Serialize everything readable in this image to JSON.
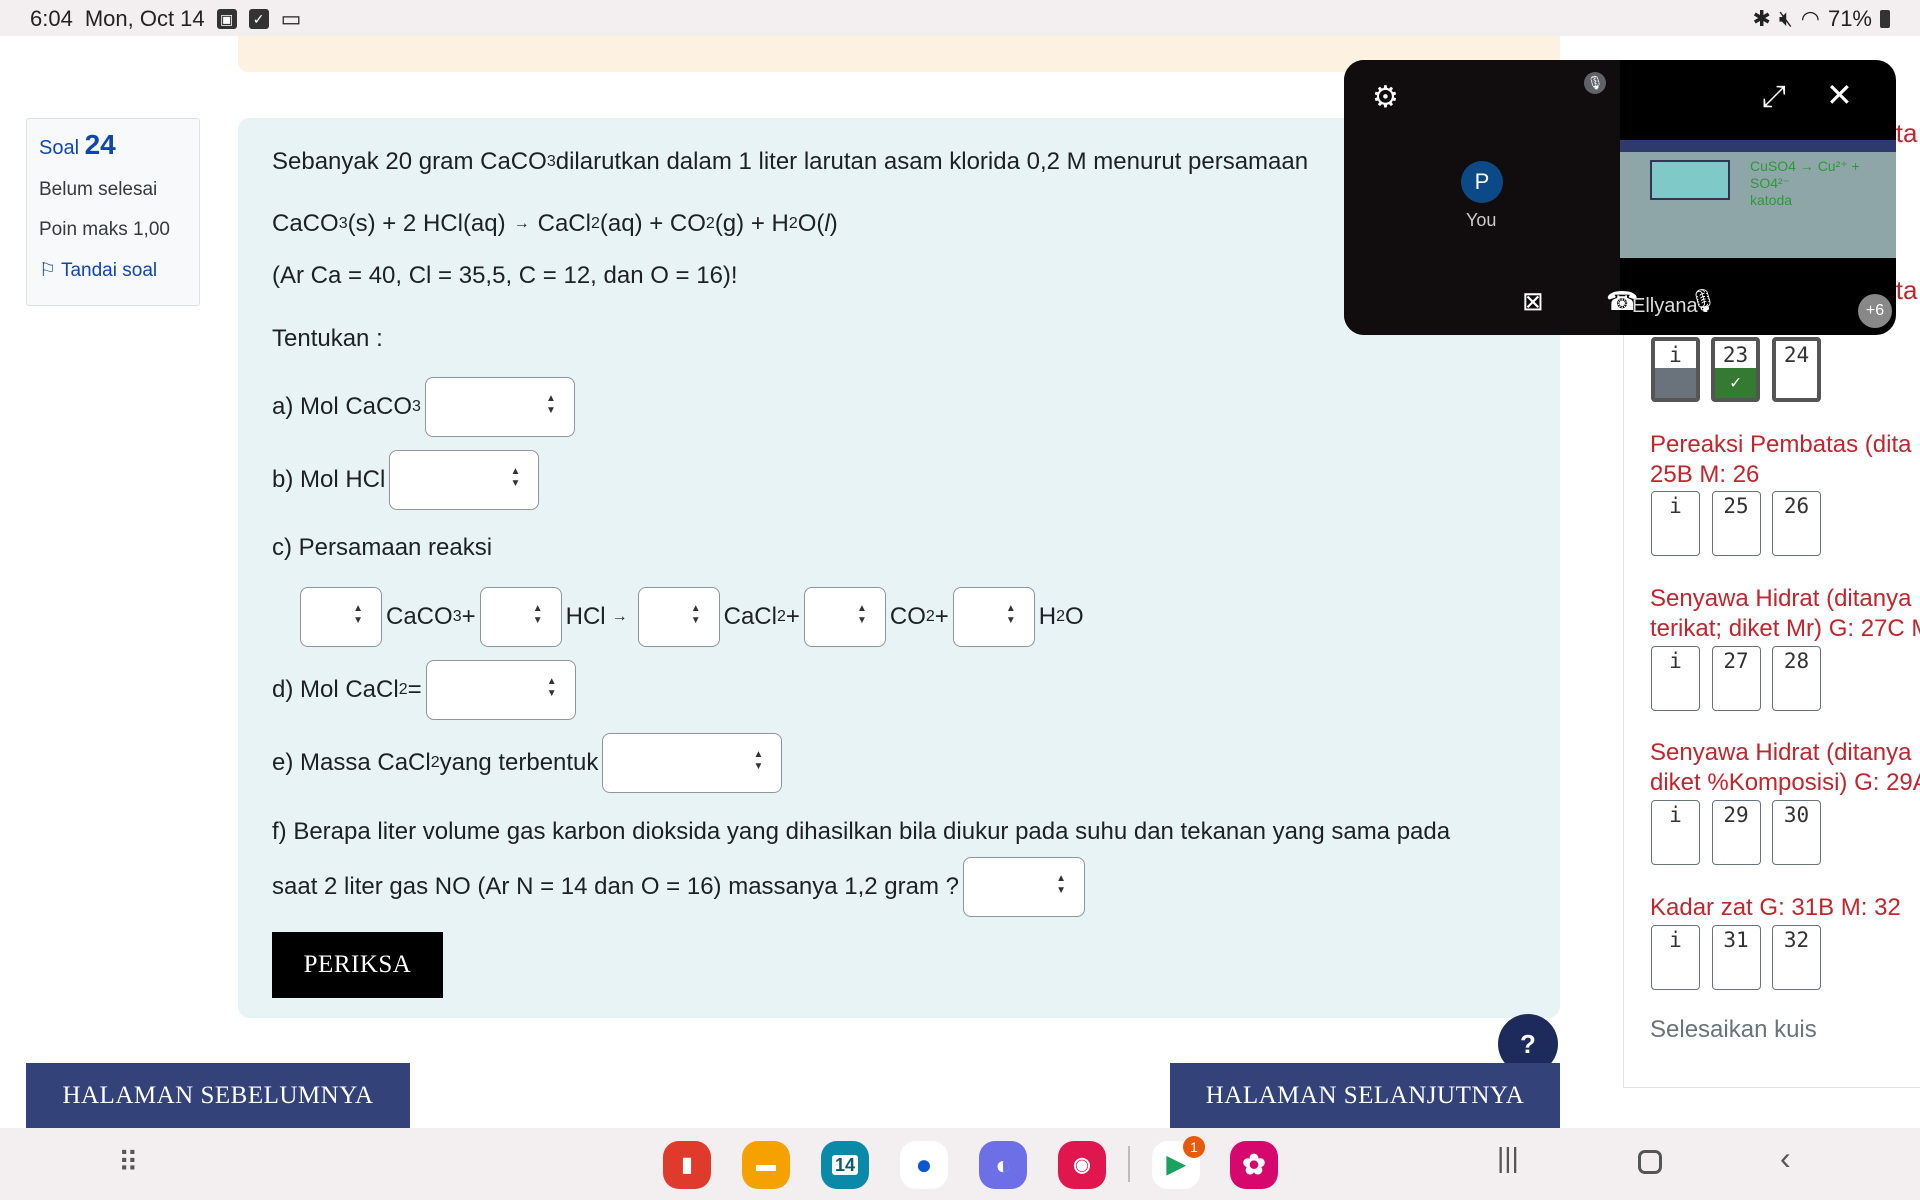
{
  "status_bar": {
    "time": "6:04",
    "date": "Mon, Oct 14",
    "battery": "71%",
    "icons": [
      "image-icon",
      "check-icon",
      "video-icon"
    ],
    "right_icons": [
      "bluetooth-icon",
      "mute-icon",
      "wifi-icon",
      "battery-icon"
    ]
  },
  "info": {
    "soal_label": "Soal",
    "soal_number": "24",
    "state": "Belum selesai",
    "points": "Poin maks 1,00",
    "flag": "Tandai soal"
  },
  "question": {
    "intro": "Sebanyak 20 gram CaCO",
    "intro_sub": "3",
    "intro_rest": " dilarutkan dalam 1 liter larutan asam klorida 0,2 M menurut persamaan",
    "ar": "(Ar Ca = 40, Cl = 35,5, C = 12, dan O = 16)!",
    "tentukan": "Tentukan :",
    "a": "a) Mol CaCO",
    "b": "b) Mol HCl",
    "c": "c) Persamaan reaksi",
    "d": "d) Mol CaCl",
    "d_eq": " =",
    "e": "e) Massa CaCl",
    "e_rest": " yang terbentuk",
    "f1": "f) Berapa liter volume gas karbon dioksida yang dihasilkan bila diukur pada suhu dan tekanan yang sama pada",
    "f2": "saat 2 liter gas NO (Ar N = 14 dan O = 16) massanya 1,2 gram ?",
    "check_button": "PERIKSA"
  },
  "navigation": {
    "prev": "HALAMAN SEBELUMNYA",
    "next": "HALAMAN SELANJUTNYA",
    "help": "?"
  },
  "quiz_nav": {
    "cut_text": "ita",
    "first_row": [
      {
        "label": "i",
        "state": "info"
      },
      {
        "label": "23",
        "state": "answered"
      },
      {
        "label": "24",
        "state": "current"
      }
    ],
    "groups": [
      {
        "title1": "Pereaksi Pembatas (dita",
        "title2": "25B M: 26",
        "items": [
          "i",
          "25",
          "26"
        ]
      },
      {
        "title1": "Senyawa Hidrat (ditanya",
        "title2": "terikat; diket Mr) G: 27C M",
        "items": [
          "i",
          "27",
          "28"
        ]
      },
      {
        "title1": "Senyawa Hidrat (ditanya",
        "title2": "diket %Komposisi) G: 29A",
        "items": [
          "i",
          "29",
          "30"
        ]
      },
      {
        "title1": "Kadar zat G: 31B M: 32",
        "title2": "",
        "items": [
          "i",
          "31",
          "32"
        ]
      }
    ],
    "finish": "Selesaikan kuis",
    "colors": {
      "answered": "#357a32",
      "info": "#6a737b",
      "heading": "#c0262d"
    }
  },
  "meet": {
    "you_initial": "P",
    "you_label": "You",
    "participant": "Ellyana",
    "more": "+6"
  },
  "dock": {
    "apps": [
      "notes",
      "files",
      "calendar",
      "messages",
      "internet",
      "camera",
      "meet",
      "gallery"
    ],
    "calendar_day": "14",
    "meet_badge": "1"
  }
}
